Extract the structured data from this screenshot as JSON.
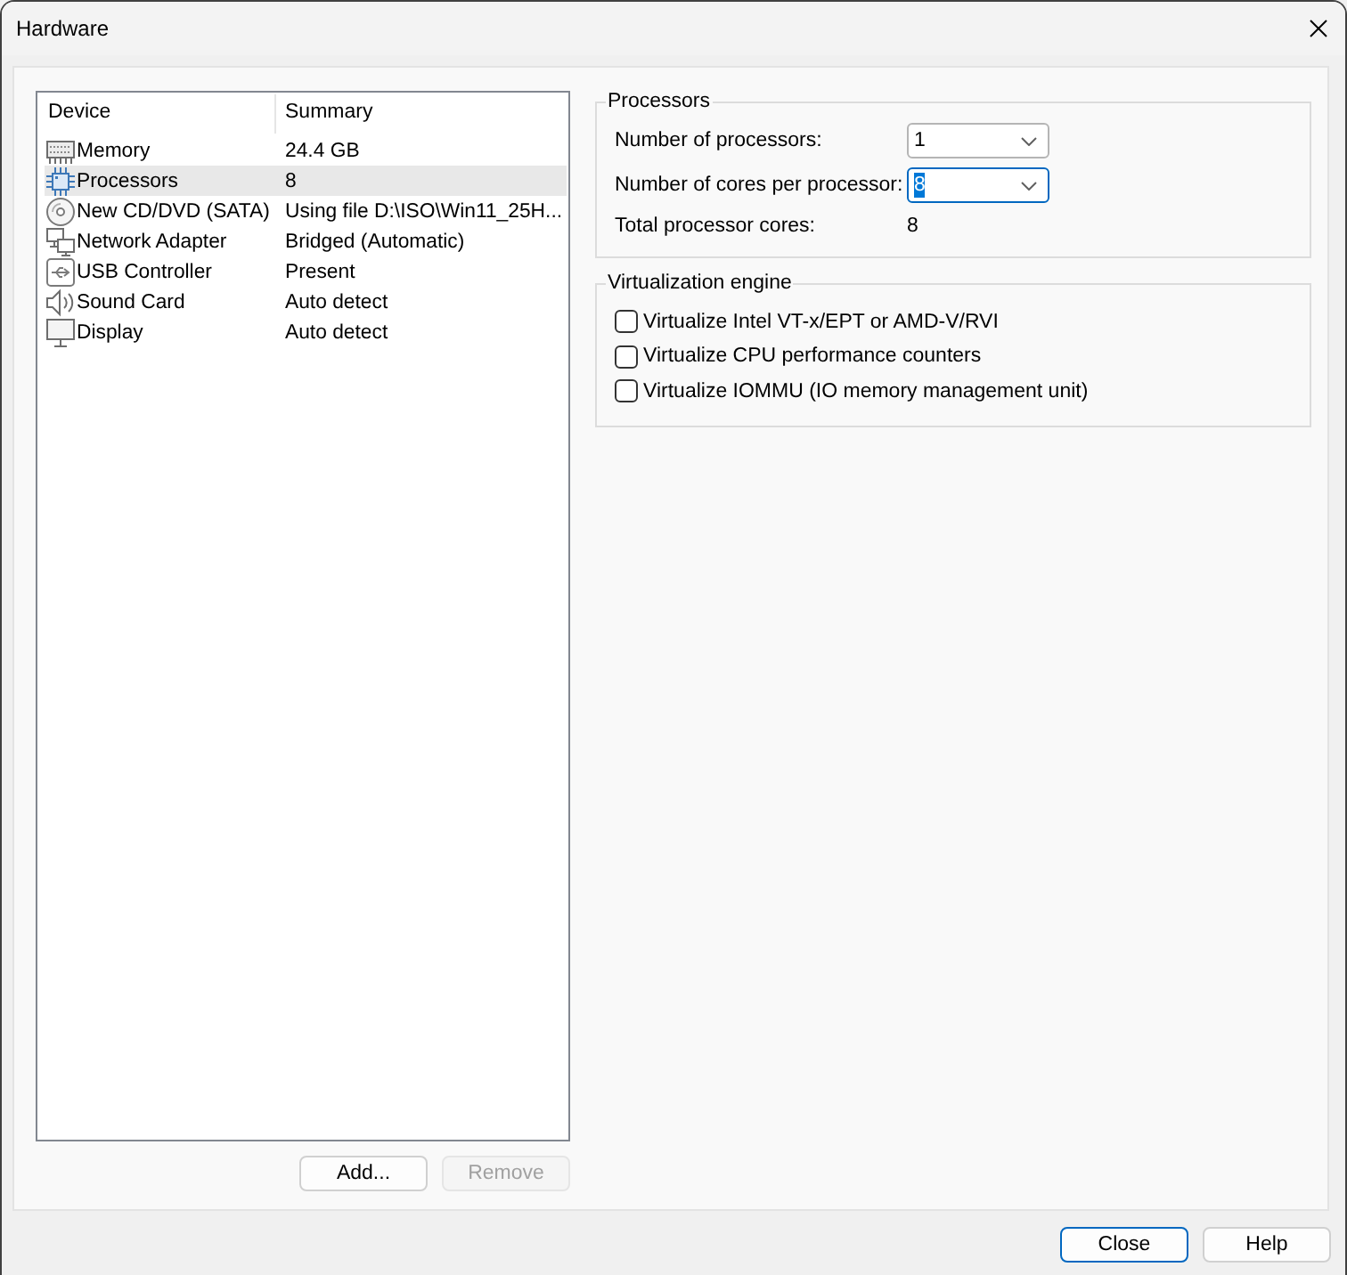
{
  "window": {
    "title": "Hardware"
  },
  "devices": {
    "columns": [
      "Device",
      "Summary"
    ],
    "rows": [
      {
        "kind": "memory",
        "device": "Memory",
        "summary": "24.4 GB",
        "selected": false
      },
      {
        "kind": "processor",
        "device": "Processors",
        "summary": "8",
        "selected": true
      },
      {
        "kind": "cd",
        "device": "New CD/DVD (SATA)",
        "summary": "Using file D:\\ISO\\Win11_25H...",
        "selected": false
      },
      {
        "kind": "network",
        "device": "Network Adapter",
        "summary": "Bridged (Automatic)",
        "selected": false
      },
      {
        "kind": "usb",
        "device": "USB Controller",
        "summary": "Present",
        "selected": false
      },
      {
        "kind": "sound",
        "device": "Sound Card",
        "summary": "Auto detect",
        "selected": false
      },
      {
        "kind": "display",
        "device": "Display",
        "summary": "Auto detect",
        "selected": false
      }
    ]
  },
  "device_buttons": [
    {
      "label": "Add...",
      "disabled": false
    },
    {
      "label": "Remove",
      "disabled": true
    }
  ],
  "processors": {
    "title": "Processors",
    "fields": [
      {
        "kind": "combo",
        "label": "Number of processors:",
        "value": "1",
        "focused": false
      },
      {
        "kind": "combo",
        "label": "Number of cores per processor:",
        "value": "8",
        "focused": true
      },
      {
        "kind": "readout",
        "label": "Total processor cores:",
        "value": "8"
      }
    ]
  },
  "virtualization": {
    "title": "Virtualization engine",
    "options": [
      {
        "label": "Virtualize Intel VT-x/EPT or AMD-V/RVI",
        "checked": false
      },
      {
        "label": "Virtualize CPU performance counters",
        "checked": false
      },
      {
        "label": "Virtualize IOMMU (IO memory management unit)",
        "checked": false
      }
    ]
  },
  "footer_buttons": [
    {
      "label": "Close",
      "default": true
    },
    {
      "label": "Help",
      "default": false
    }
  ]
}
